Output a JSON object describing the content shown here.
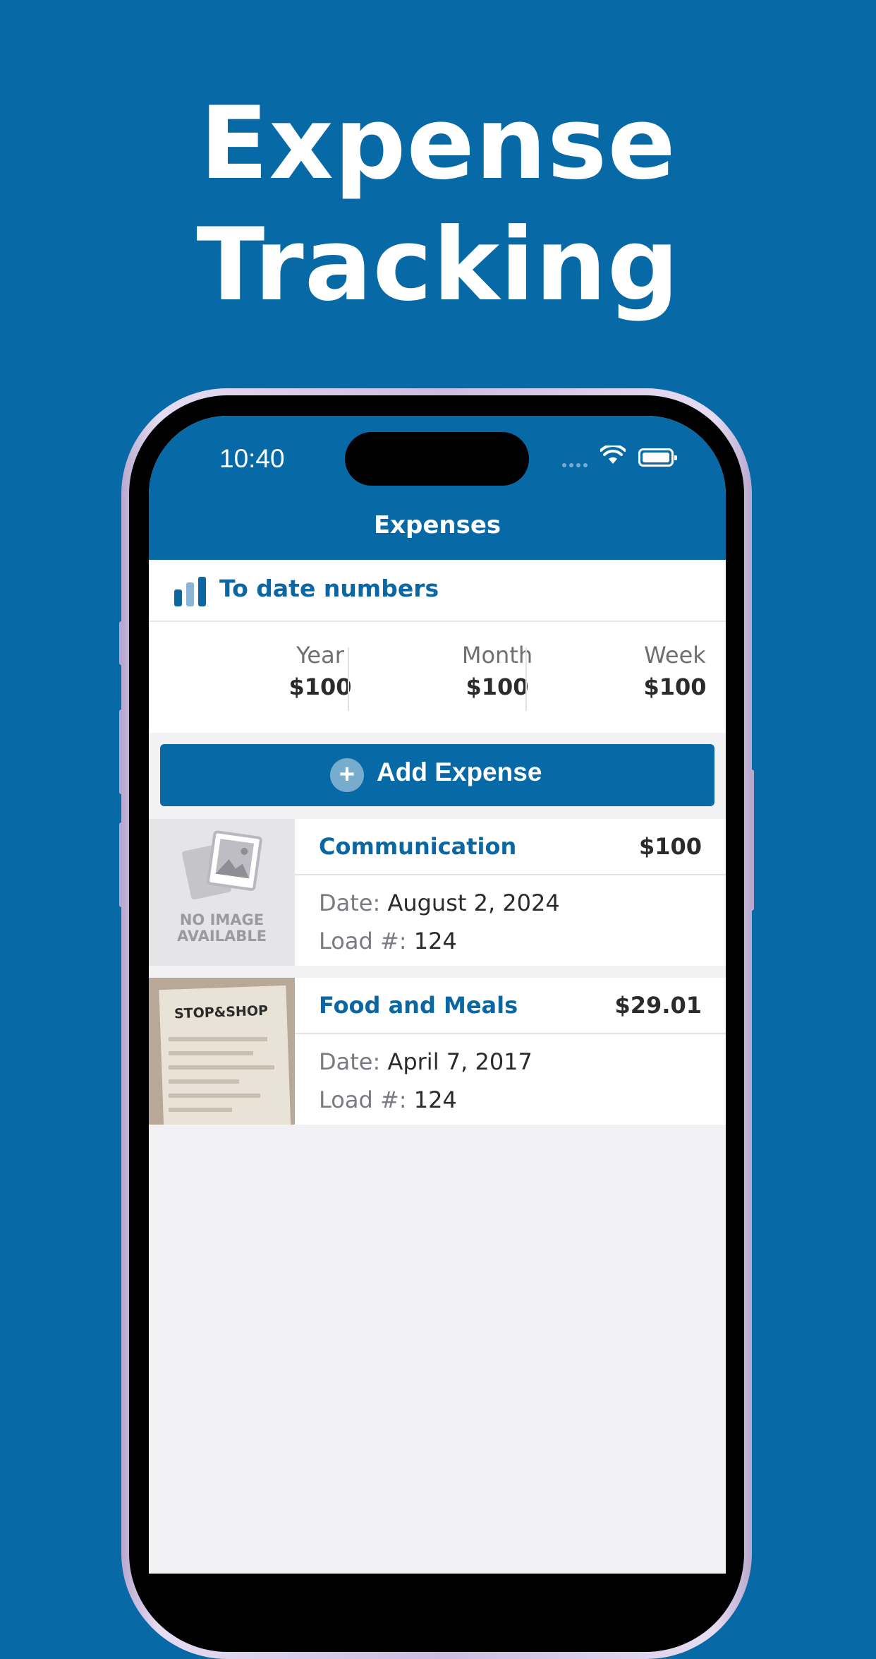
{
  "headline": {
    "line1": "Expense",
    "line2": "Tracking"
  },
  "status_bar": {
    "time": "10:40"
  },
  "nav": {
    "title": "Expenses"
  },
  "stats": {
    "title": "To date numbers",
    "items": [
      {
        "label": "Year",
        "value": "$100"
      },
      {
        "label": "Month",
        "value": "$100"
      },
      {
        "label": "Week",
        "value": "$100"
      }
    ]
  },
  "add_button": {
    "icon": "plus-icon",
    "label": "Add Expense"
  },
  "expenses": [
    {
      "category": "Communication",
      "amount": "$100",
      "date_label": "Date:",
      "date": "August 2, 2024",
      "load_label": "Load #:",
      "load": "124",
      "thumbnail_text_1": "NO IMAGE",
      "thumbnail_text_2": "AVAILABLE"
    },
    {
      "category": "Food and Meals",
      "amount": "$29.01",
      "date_label": "Date:",
      "date": "April 7, 2017",
      "load_label": "Load #:",
      "load": "124",
      "receipt_store": "STOP&SHOP"
    }
  ],
  "colors": {
    "brand": "#0869a7",
    "accent_text": "#0b67a3",
    "background": "#f2f2f5"
  }
}
